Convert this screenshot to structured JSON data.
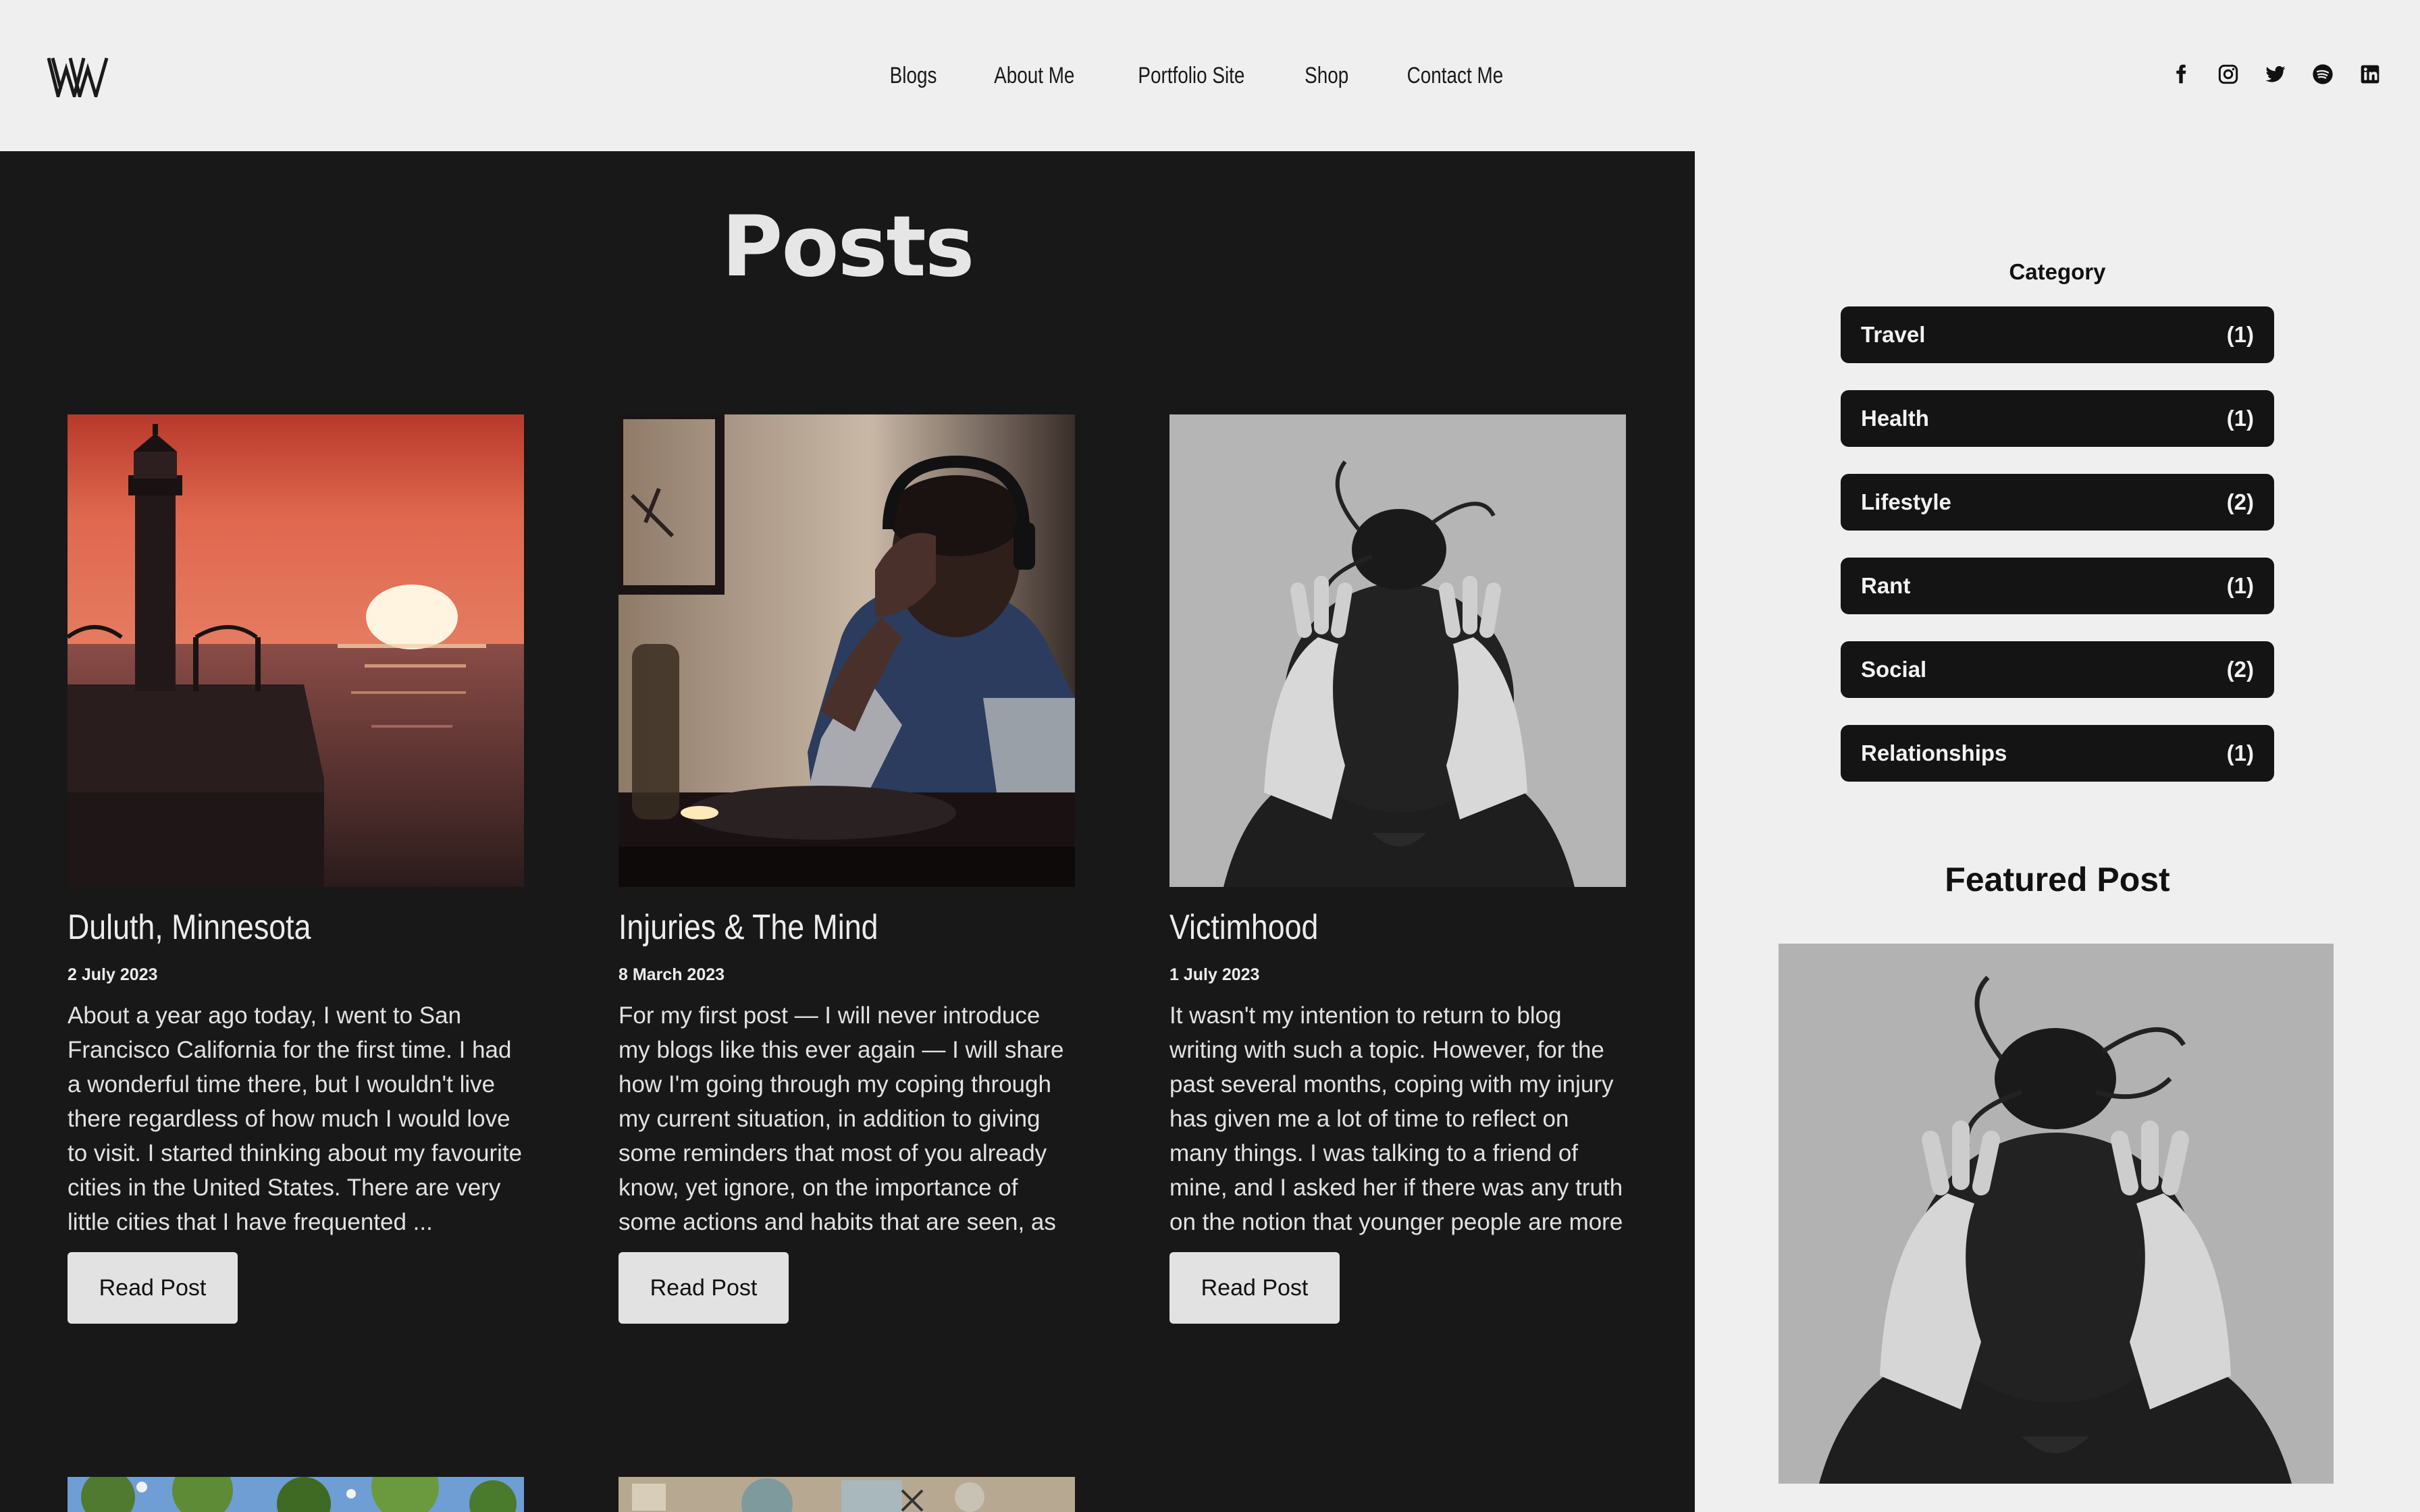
{
  "header": {
    "logo_text": "W",
    "nav": [
      "Blogs",
      "About Me",
      "Portfolio Site",
      "Shop",
      "Contact Me"
    ],
    "social_icons": [
      "facebook-icon",
      "instagram-icon",
      "twitter-icon",
      "spotify-icon",
      "linkedin-icon"
    ]
  },
  "main": {
    "title": "Posts",
    "posts": [
      {
        "title": "Duluth, Minnesota",
        "date": "2 July 2023",
        "excerpt": "About a year ago today, I went to San Francisco California for the first time. I had a wonderful time there, but I wouldn't live there regardless of how much I would love to visit. I started thinking about my favourite cities in the United States. There are very little cities that I have frequented ...",
        "button": "Read Post"
      },
      {
        "title": "Injuries & The Mind",
        "date": "8 March 2023",
        "excerpt": "For my first post — I will never introduce my blogs like this ever again — I will share how I'm going through my coping through my current situation, in addition to giving some reminders that most of you already know, yet ignore, on the importance of some actions and habits that are seen, as otherwi...",
        "button": "Read Post"
      },
      {
        "title": "Victimhood",
        "date": "1 July 2023",
        "excerpt": "It wasn't my intention to return to blog writing with such a topic. However, for the past several months, coping with my injury has given me a lot of time to reflect on many things. I was talking to a friend of mine, and I asked her if there was any truth on the notion that younger people are more e...",
        "button": "Read Post"
      }
    ]
  },
  "sidebar": {
    "category_title": "Category",
    "categories": [
      {
        "name": "Travel",
        "count": "(1)"
      },
      {
        "name": "Health",
        "count": "(1)"
      },
      {
        "name": "Lifestyle",
        "count": "(2)"
      },
      {
        "name": "Rant",
        "count": "(1)"
      },
      {
        "name": "Social",
        "count": "(2)"
      },
      {
        "name": "Relationships",
        "count": "(1)"
      }
    ],
    "featured_title": "Featured Post"
  },
  "colors": {
    "page_bg": "#efefef",
    "main_bg": "#181818",
    "button_bg": "#e2e2e2",
    "category_bg": "#141414"
  }
}
